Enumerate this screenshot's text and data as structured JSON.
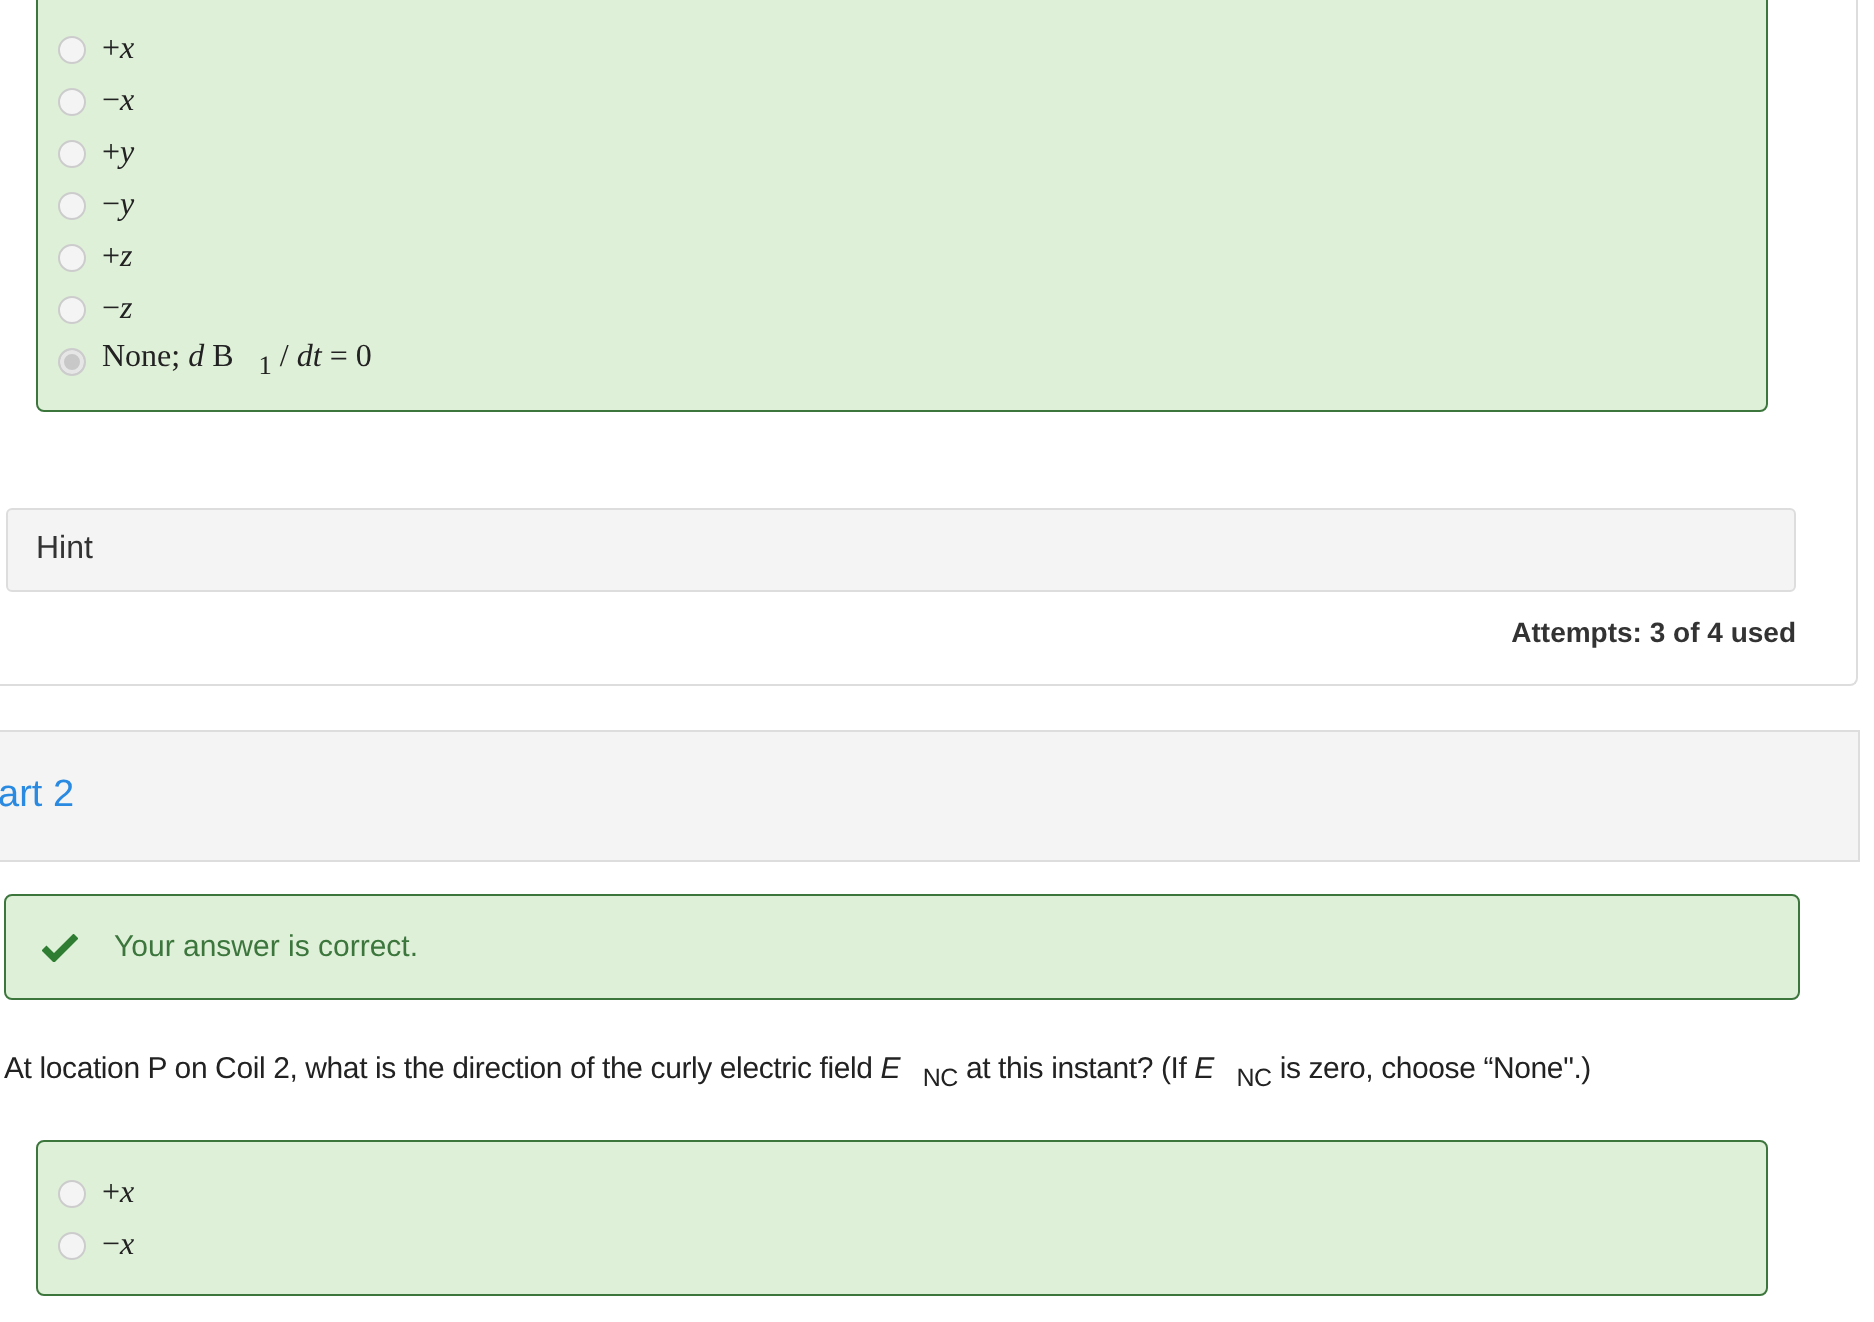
{
  "part1": {
    "options": [
      {
        "label": "+*x*",
        "selected": false
      },
      {
        "label": "−*x*",
        "selected": false
      },
      {
        "label": "+*y*",
        "selected": false
      },
      {
        "label": "−*y*",
        "selected": false
      },
      {
        "label": "+*z*",
        "selected": false
      },
      {
        "label": "−*z*",
        "selected": false
      },
      {
        "label": "None; *d* B⃗$_{1}$ / *dt* = 0⃗",
        "selected": true
      }
    ],
    "hint": "Hint",
    "attempts": "Attempts: 3 of 4 used"
  },
  "part2": {
    "title": "art 2",
    "feedback": {
      "correct": true,
      "text": "Your answer is correct."
    },
    "question": "At location P on Coil 2, what is the direction of the curly electric field *E⃗*$_{NC}$ at this instant? (If *E⃗*$_{NC}$ is zero, choose “None\".)",
    "options": [
      {
        "label": "+*x*",
        "selected": false
      },
      {
        "label": "−*x*",
        "selected": false
      }
    ]
  }
}
